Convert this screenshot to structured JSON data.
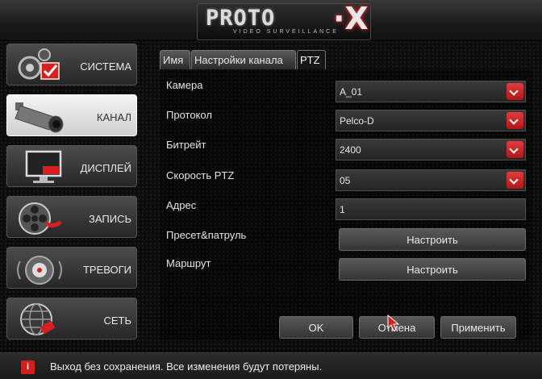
{
  "header": {
    "logo_main": "PROTO",
    "logo_x": "·X",
    "logo_sub": "VIDEO SURVEILLANCE"
  },
  "sidebar": {
    "items": [
      {
        "label": "СИСТЕМА",
        "icon": "gears-checkbox-icon",
        "active": false
      },
      {
        "label": "КАНАЛ",
        "icon": "camera-icon",
        "active": true
      },
      {
        "label": "ДИСПЛЕЙ",
        "icon": "monitor-icon",
        "active": false
      },
      {
        "label": "ЗАПИСЬ",
        "icon": "film-reel-icon",
        "active": false
      },
      {
        "label": "ТРЕВОГИ",
        "icon": "alarm-bell-icon",
        "active": false
      },
      {
        "label": "СЕТЬ",
        "icon": "globe-network-icon",
        "active": false
      }
    ]
  },
  "tabs": [
    {
      "label": "Имя",
      "active": false
    },
    {
      "label": "Настройки канала",
      "active": false
    },
    {
      "label": "PTZ",
      "active": true
    }
  ],
  "form": {
    "camera": {
      "label": "Камера",
      "value": "A_01"
    },
    "protocol": {
      "label": "Протокол",
      "value": "Pelco-D"
    },
    "bitrate": {
      "label": "Битрейт",
      "value": "2400"
    },
    "ptz_speed": {
      "label": "Скорость PTZ",
      "value": "05"
    },
    "address": {
      "label": "Адрес",
      "value": "1"
    },
    "preset": {
      "label": "Пресет&патруль",
      "button": "Настроить"
    },
    "route": {
      "label": "Маршрут",
      "button": "Настроить"
    }
  },
  "footer_buttons": {
    "ok": "OK",
    "cancel": "Отмена",
    "apply": "Применить"
  },
  "status": {
    "icon": "i",
    "text": "Выход без сохранения. Все изменения будут потеряны."
  },
  "colors": {
    "accent": "#c81e1e",
    "background": "#0a0a0a",
    "active_item": "#e8e8e8"
  }
}
